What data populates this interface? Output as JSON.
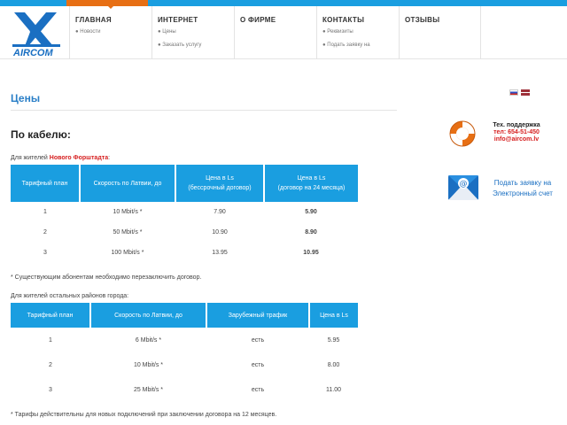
{
  "brand": {
    "logo_text": "AIRCOM"
  },
  "nav": [
    {
      "title": "ГЛАВНАЯ",
      "subs": [
        "● Новости"
      ]
    },
    {
      "title": "ИНТЕРНЕТ",
      "subs": [
        "● Цены",
        "● Заказать услугу"
      ]
    },
    {
      "title": "О ФИРМЕ",
      "subs": []
    },
    {
      "title": "КОНТАКТЫ",
      "subs": [
        "● Реквизиты",
        "● Подать заявку на"
      ]
    },
    {
      "title": "ОТЗЫВЫ",
      "subs": []
    }
  ],
  "page": {
    "title": "Цены",
    "section_title": "По кабелю:"
  },
  "note1": {
    "prefix": "Для жителей ",
    "highlight": "Нового Форштадта",
    "suffix": ":"
  },
  "table1": {
    "headers": [
      "Тарифный план",
      "Скорость по Латвии, до",
      "Цена в Ls\n(бессрочный договор)",
      "Цена в Ls\n(договор на 24 месяца)"
    ],
    "rows": [
      [
        "1",
        "10 Mbit/s *",
        "7.90",
        "5.90"
      ],
      [
        "2",
        "50 Mbit/s *",
        "10.90",
        "8.90"
      ],
      [
        "3",
        "100 Mbit/s *",
        "13.95",
        "10.95"
      ]
    ]
  },
  "footnote1": "* Существующим абонентам необходимо перезаключить договор.",
  "note2": "Для жителей остальных районов города:",
  "table2": {
    "headers": [
      "Тарифный план",
      "Скорость по Латвии, до",
      "Зарубежный трафик",
      "Цена в Ls"
    ],
    "rows": [
      [
        "1",
        "6 Mbit/s *",
        "есть",
        "5.95"
      ],
      [
        "2",
        "10 Mbit/s *",
        "есть",
        "8.00"
      ],
      [
        "3",
        "25 Mbit/s *",
        "есть",
        "11.00"
      ]
    ]
  },
  "footnote2": "* Тарифы действительны для новых подключений при заключении договора на 12 месяцев.",
  "support": {
    "title": "Тех. поддержка",
    "phone": "тел: 654-51-450",
    "email": "info@aircom.lv"
  },
  "order": {
    "line1": "Подать заявку на",
    "line2": "Электронный счет"
  },
  "colors": {
    "accent": "#1a9ee0",
    "orange": "#e76f14",
    "red": "#d62020"
  }
}
